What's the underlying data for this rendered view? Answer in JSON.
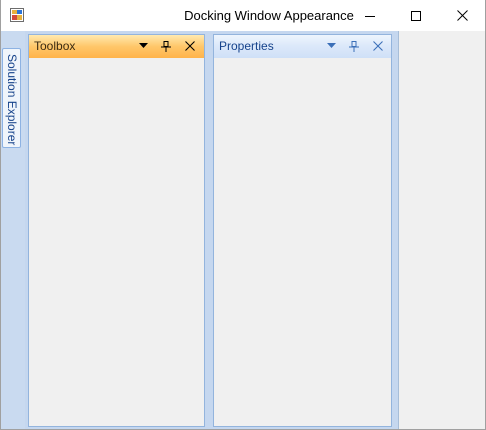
{
  "window": {
    "title": "Docking Window Appearance",
    "controls": {
      "minimize": "minimize-icon",
      "maximize": "maximize-icon",
      "close": "close-icon"
    }
  },
  "side_tabs": [
    {
      "label": "Solution Explorer"
    }
  ],
  "panes": {
    "toolbox": {
      "title": "Toolbox",
      "icons": [
        "dropdown-arrow-icon",
        "pin-icon",
        "close-icon"
      ]
    },
    "properties": {
      "title": "Properties",
      "icons": [
        "dropdown-arrow-icon",
        "pin-icon",
        "close-icon"
      ]
    }
  },
  "colors": {
    "active_header": "#ffc76a",
    "inactive_header": "#dbe8fa",
    "dock_background": "#c5d7ef",
    "tab_text": "#15428b"
  }
}
